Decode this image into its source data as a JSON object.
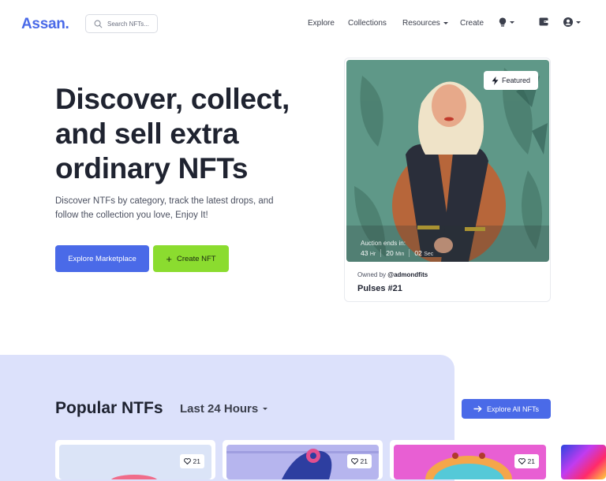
{
  "brand": {
    "logo": "Assan."
  },
  "search": {
    "placeholder": "Search NFTs..."
  },
  "nav": {
    "explore": "Explore",
    "collections": "Collections",
    "resources": "Resources",
    "create": "Create"
  },
  "hero": {
    "title": "Discover, collect, and sell extra ordinary NFTs",
    "subtitle": "Discover NTFs by category, track the latest drops, and follow the collection you love, Enjoy It!",
    "primary_button": "Explore Marketplace",
    "secondary_button": "Create NFT"
  },
  "featured": {
    "badge": "Featured",
    "auction_label": "Auction ends in:",
    "hours": "43",
    "hours_unit": "Hr",
    "minutes": "20",
    "minutes_unit": "Min",
    "seconds": "02",
    "seconds_unit": "Sec",
    "owned_prefix": "Owned by",
    "owner": "@admondfits",
    "name": "Pulses #21"
  },
  "popular": {
    "title": "Popular NTFs",
    "filter": "Last 24 Hours",
    "explore_all": "Explore All NFTs",
    "cards": [
      {
        "likes": "21"
      },
      {
        "likes": "21"
      },
      {
        "likes": "21"
      }
    ]
  },
  "colors": {
    "brand": "#4a6ae8",
    "green": "#8bdc2f",
    "section_bg": "#dce1fb"
  }
}
